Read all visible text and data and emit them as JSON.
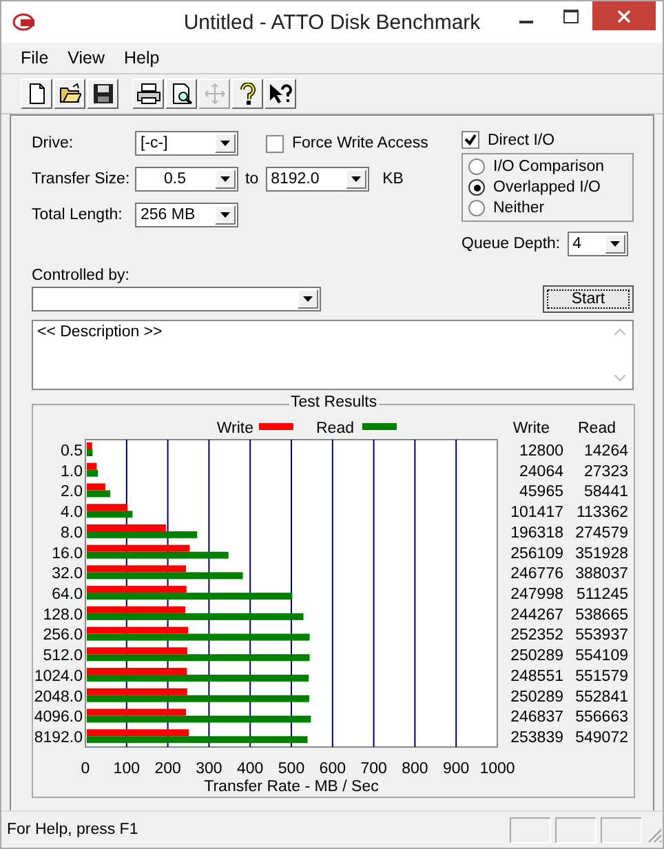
{
  "window": {
    "title": "Untitled - ATTO Disk Benchmark"
  },
  "menu": [
    "File",
    "View",
    "Help"
  ],
  "toolbar": [
    {
      "kind": "new",
      "disabled": false
    },
    {
      "kind": "open",
      "disabled": false
    },
    {
      "kind": "save",
      "disabled": false
    },
    {
      "kind": "separator"
    },
    {
      "kind": "print",
      "disabled": false
    },
    {
      "kind": "preview",
      "disabled": false
    },
    {
      "kind": "move",
      "disabled": true
    },
    {
      "kind": "help",
      "disabled": false
    },
    {
      "kind": "context-help",
      "disabled": false
    }
  ],
  "settings": {
    "drive": {
      "label": "Drive:",
      "value": "[-c-]"
    },
    "transfer_size": {
      "label": "Transfer Size:",
      "from": "0.5",
      "to_label": "to",
      "to": "8192.0",
      "unit": "KB"
    },
    "total_length": {
      "label": "Total Length:",
      "value": "256 MB"
    },
    "force_write_access": {
      "label": "Force Write Access",
      "checked": false
    },
    "direct_io": {
      "label": "Direct I/O",
      "checked": true
    },
    "io_modes": [
      {
        "label": "I/O Comparison",
        "selected": false
      },
      {
        "label": "Overlapped I/O",
        "selected": true
      },
      {
        "label": "Neither",
        "selected": false
      }
    ],
    "queue_depth": {
      "label": "Queue Depth:",
      "value": "4"
    },
    "controlled_by": {
      "label": "Controlled by:"
    },
    "start_button": "Start",
    "description": "<< Description >>"
  },
  "results": {
    "title": "Test Results",
    "columns": [
      "Write",
      "Read"
    ],
    "rows": [
      {
        "write": "12800",
        "read": "14264"
      },
      {
        "write": "24064",
        "read": "27323"
      },
      {
        "write": "45965",
        "read": "58441"
      },
      {
        "write": "101417",
        "read": "113362"
      },
      {
        "write": "196318",
        "read": "274579"
      },
      {
        "write": "256109",
        "read": "351928"
      },
      {
        "write": "246776",
        "read": "388037"
      },
      {
        "write": "247998",
        "read": "511245"
      },
      {
        "write": "244267",
        "read": "538665"
      },
      {
        "write": "252352",
        "read": "553937"
      },
      {
        "write": "250289",
        "read": "554109"
      },
      {
        "write": "248551",
        "read": "551579"
      },
      {
        "write": "250289",
        "read": "552841"
      },
      {
        "write": "246837",
        "read": "556663"
      },
      {
        "write": "253839",
        "read": "549072"
      }
    ],
    "chart_data": {
      "type": "bar",
      "orientation": "horizontal",
      "xlabel": "Transfer Rate - MB / Sec",
      "categories": [
        "0.5",
        "1.0",
        "2.0",
        "4.0",
        "8.0",
        "16.0",
        "32.0",
        "64.0",
        "128.0",
        "256.0",
        "512.0",
        "1024.0",
        "2048.0",
        "4096.0",
        "8192.0"
      ],
      "series": [
        {
          "name": "Write",
          "color": "#ff0000",
          "values": [
            13,
            24,
            45,
            99,
            192,
            250,
            241,
            242,
            239,
            246,
            244,
            243,
            244,
            241,
            248
          ]
        },
        {
          "name": "Read",
          "color": "#008000",
          "values": [
            14,
            27,
            57,
            111,
            268,
            344,
            379,
            499,
            526,
            541,
            541,
            539,
            540,
            544,
            536
          ]
        }
      ],
      "grid": true,
      "legend": true,
      "xlim": [
        0,
        1000
      ],
      "xticks": [
        0,
        100,
        200,
        300,
        400,
        500,
        600,
        700,
        800,
        900,
        1000
      ]
    }
  },
  "status_bar": {
    "text": "For Help, press F1"
  }
}
